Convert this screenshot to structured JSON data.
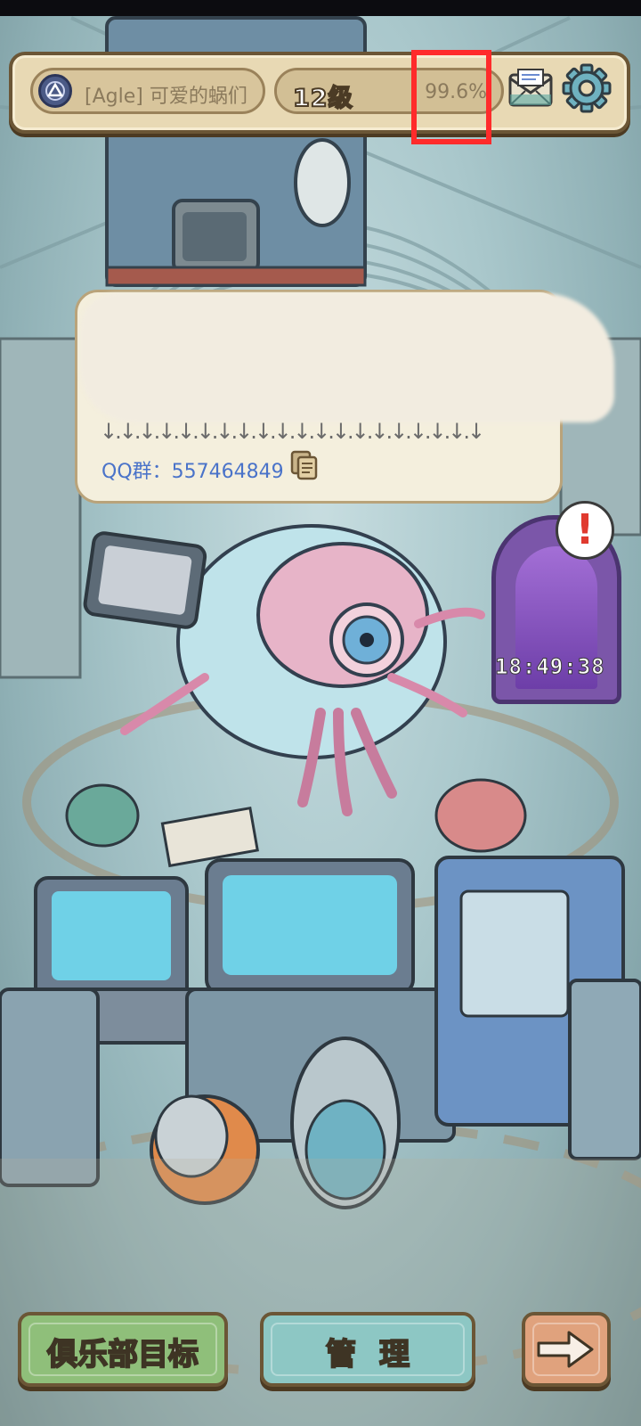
{
  "top_bar": {
    "player_name": "[Agle] 可爱的蜗们",
    "level": "12级",
    "progress_percent": "99.6%",
    "progress_fraction": 0.996,
    "avatar_icon": "triangle-emblem-icon",
    "mail_icon": "mail-icon",
    "settings_icon": "gear-icon",
    "highlight_color": "#ff2b2b"
  },
  "notice": {
    "arrows": "↓.↓.↓.↓.↓.↓.↓.↓.↓.↓.↓.↓.↓.↓.↓.↓.↓.↓.↓.↓",
    "qq_group": "QQ群：557464849",
    "copy_icon": "copy-icon"
  },
  "scene": {
    "portal_timer": "18:49:38",
    "alert_mark": "!"
  },
  "bottom_buttons": {
    "club_goal": "俱乐部目标",
    "manage": "管理",
    "next_icon": "arrow-right-icon"
  }
}
